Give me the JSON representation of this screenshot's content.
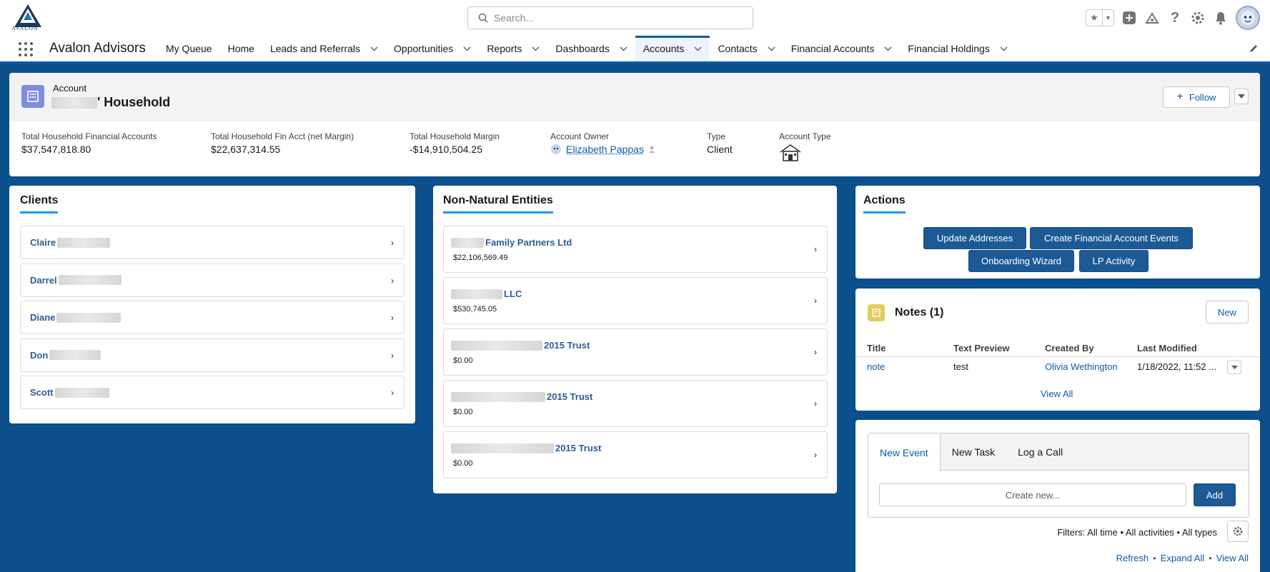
{
  "header": {
    "logo_text": "AVALON",
    "search_placeholder": "Search...",
    "icons": [
      "favorites-star-icon",
      "favorites-dropdown-icon",
      "global-add-icon",
      "trailhead-icon",
      "help-icon",
      "setup-gear-icon",
      "notifications-bell-icon",
      "user-avatar"
    ]
  },
  "nav": {
    "app_name": "Avalon Advisors",
    "items": [
      {
        "label": "My Queue",
        "dropdown": false
      },
      {
        "label": "Home",
        "dropdown": false
      },
      {
        "label": "Leads and Referrals",
        "dropdown": true
      },
      {
        "label": "Opportunities",
        "dropdown": true
      },
      {
        "label": "Reports",
        "dropdown": true
      },
      {
        "label": "Dashboards",
        "dropdown": true
      },
      {
        "label": "Accounts",
        "dropdown": true,
        "active": true
      },
      {
        "label": "Contacts",
        "dropdown": true
      },
      {
        "label": "Financial Accounts",
        "dropdown": true
      },
      {
        "label": "Financial Holdings",
        "dropdown": true
      }
    ]
  },
  "account": {
    "object_label": "Account",
    "name_suffix": "' Household",
    "follow_label": "Follow",
    "fields": {
      "total_fa_label": "Total Household Financial Accounts",
      "total_fa_value": "$37,547,818.80",
      "net_margin_label": "Total Household Fin Acct (net Margin)",
      "net_margin_value": "$22,637,314.55",
      "margin_label": "Total Household Margin",
      "margin_value": "-$14,910,504.25",
      "owner_label": "Account Owner",
      "owner_value": "Elizabeth Pappas",
      "type_label": "Type",
      "type_value": "Client",
      "account_type_label": "Account Type"
    }
  },
  "clients": {
    "title": "Clients",
    "items": [
      "Claire",
      "Darrel",
      "Diane",
      "Don",
      "Scott"
    ]
  },
  "entities": {
    "title": "Non-Natural Entities",
    "items": [
      {
        "name": "Family Partners Ltd",
        "amount": "$22,106,569.49"
      },
      {
        "name": "LLC",
        "amount": "$530,745.05"
      },
      {
        "name": "2015 Trust",
        "amount": "$0.00"
      },
      {
        "name": "2015 Trust",
        "amount": "$0.00"
      },
      {
        "name": "2015 Trust",
        "amount": "$0.00"
      }
    ]
  },
  "actions": {
    "title": "Actions",
    "buttons": [
      "Update Addresses",
      "Create Financial Account Events",
      "Onboarding Wizard",
      "LP Activity"
    ]
  },
  "notes": {
    "title": "Notes (1)",
    "new_label": "New",
    "columns": [
      "Title",
      "Text Preview",
      "Created By",
      "Last Modified"
    ],
    "rows": [
      {
        "title": "note",
        "preview": "test",
        "created_by": "Olivia Wethington",
        "modified": "1/18/2022, 11:52 ..."
      }
    ],
    "view_all": "View All"
  },
  "activity": {
    "tabs": [
      "New Event",
      "New Task",
      "Log a Call"
    ],
    "input_placeholder": "Create new...",
    "add_label": "Add",
    "filters": "Filters: All time • All activities • All types",
    "links": [
      "Refresh",
      "Expand All",
      "View All"
    ]
  },
  "colors": {
    "page_bg": "#0b4f8c",
    "brand": "#1c5a96",
    "link": "#0b5cab",
    "tab_underline": "#1b96ff",
    "account_icon": "#7f8de1",
    "notes_icon": "#e3cc5b"
  }
}
